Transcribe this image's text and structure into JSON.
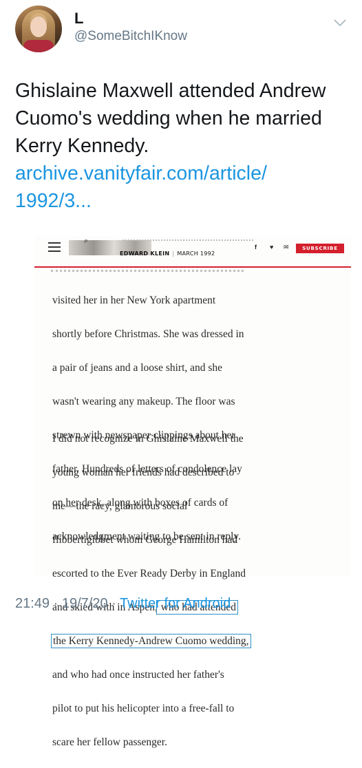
{
  "user": {
    "display_name": "L",
    "handle": "@SomeBitchIKnow"
  },
  "tweet": {
    "text": "Ghislaine Maxwell attended Andrew Cuomo's wedding when he married Kerry Kennedy.",
    "link_line1": "archive.vanityfair.com/article/",
    "link_line2": "1992/3..."
  },
  "article": {
    "author": "EDWARD KLEIN",
    "separator": "|",
    "date": "MARCH 1992",
    "social_f": "f",
    "social_t": "♥",
    "social_mail": "✉",
    "subscribe": "SUBSCRIBE",
    "p1_lines": [
      "visited her in her New York apartment",
      "shortly before Christmas. She was dressed in",
      "a pair of jeans and a loose shirt, and she",
      "wasn't wearing any makeup. The floor was",
      "strewn with newspaper clippings about her",
      "father. Hundreds of letters of condolence lay",
      "on her desk, along with boxes of cards of",
      "acknowledgment waiting to be sent in reply."
    ],
    "p2_lines": [
      "I did not recognize in Ghislaine Maxwell the",
      "young woman her friends had described to",
      "me—the racy, glamorous social",
      "flibbertigibbet whom George Hamilton had",
      "escorted to the Ever Ready Derby in England"
    ],
    "p2_line6_pre": "and skied with in Aspen,",
    "p2_line6_hl": " who had attended",
    "p2_line7_hl": "the Kerry Kennedy-Andrew Cuomo wedding,",
    "p2_rest_lines": [
      "and who had once instructed her father's",
      "pilot to put his helicopter into a free-fall to",
      "scare her fellow passenger."
    ]
  },
  "footer": {
    "time": "21:49",
    "dot1": "·",
    "date": "19/7/20",
    "dot2": "·",
    "client": "Twitter for Android"
  },
  "colors": {
    "link": "#1b95e0",
    "muted": "#657786",
    "subscribe_red": "#d41f2c",
    "highlight_box": "#2c8fc6"
  },
  "icons": [
    "caret-down-icon",
    "menu-icon",
    "search-icon",
    "facebook-icon",
    "twitter-icon",
    "mail-icon"
  ]
}
